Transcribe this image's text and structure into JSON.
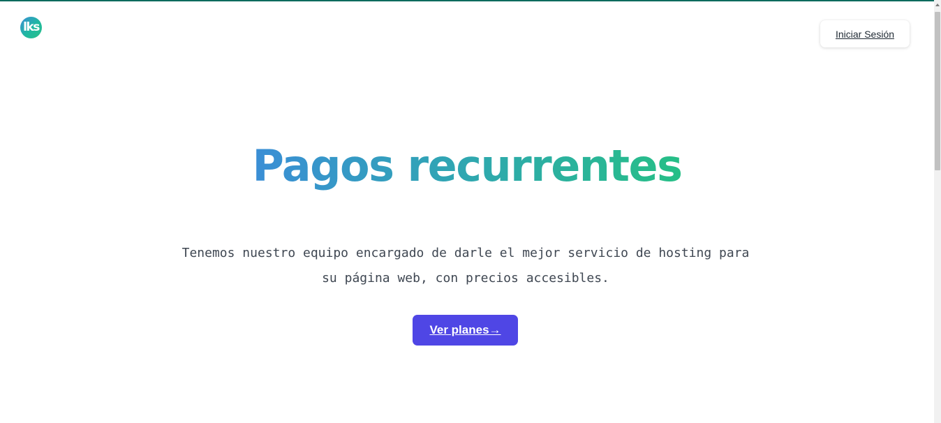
{
  "header": {
    "logo_text": "lks",
    "login_label": "Iniciar Sesión"
  },
  "hero": {
    "title": "Pagos recurrentes",
    "subtitle_line1": "Tenemos nuestro equipo encargado de darle el mejor servicio de hosting para",
    "subtitle_line2": "su página web, con precios accesibles.",
    "cta_label": "Ver planes→"
  },
  "colors": {
    "accent_top_bar": "#0b6b5d",
    "title_gradient_start": "#3a8ed6",
    "title_gradient_end": "#26bf86",
    "cta_background": "#4f46e5",
    "subtitle_text": "#3f4752"
  },
  "icons": {
    "logo": "lks-logo-icon",
    "scroll_up": "scroll-up-arrow-icon"
  }
}
